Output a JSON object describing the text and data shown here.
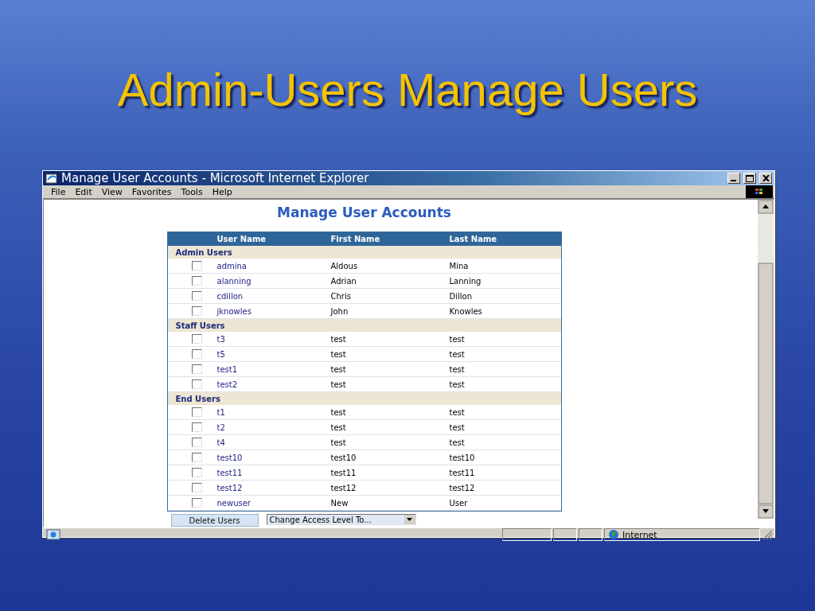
{
  "slide": {
    "title": "Admin-Users Manage Users"
  },
  "window": {
    "title": "Manage User Accounts - Microsoft Internet Explorer"
  },
  "menu": [
    "File",
    "Edit",
    "View",
    "Favorites",
    "Tools",
    "Help"
  ],
  "page": {
    "heading": "Manage User Accounts"
  },
  "table": {
    "columns": [
      "User Name",
      "First Name",
      "Last Name"
    ],
    "groups": [
      {
        "label": "Admin Users",
        "rows": [
          {
            "checked": false,
            "cells": [
              "admina",
              "Aldous",
              "Mina"
            ]
          },
          {
            "checked": false,
            "cells": [
              "alanning",
              "Adrian",
              "Lanning"
            ]
          },
          {
            "checked": false,
            "cells": [
              "cdillon",
              "Chris",
              "Dillon"
            ]
          },
          {
            "checked": false,
            "cells": [
              "jknowles",
              "John",
              "Knowles"
            ]
          }
        ]
      },
      {
        "label": "Staff Users",
        "rows": [
          {
            "checked": false,
            "cells": [
              "t3",
              "test",
              "test"
            ]
          },
          {
            "checked": false,
            "cells": [
              "t5",
              "test",
              "test"
            ]
          },
          {
            "checked": false,
            "cells": [
              "test1",
              "test",
              "test"
            ]
          },
          {
            "checked": false,
            "cells": [
              "test2",
              "test",
              "test"
            ]
          }
        ]
      },
      {
        "label": "End Users",
        "rows": [
          {
            "checked": false,
            "cells": [
              "t1",
              "test",
              "test"
            ]
          },
          {
            "checked": false,
            "cells": [
              "t2",
              "test",
              "test"
            ]
          },
          {
            "checked": false,
            "cells": [
              "t4",
              "test",
              "test"
            ]
          },
          {
            "checked": false,
            "cells": [
              "test10",
              "test10",
              "test10"
            ]
          },
          {
            "checked": false,
            "cells": [
              "test11",
              "test11",
              "test11"
            ]
          },
          {
            "checked": false,
            "cells": [
              "test12",
              "test12",
              "test12"
            ]
          },
          {
            "checked": false,
            "cells": [
              "newuser",
              "New",
              "User"
            ]
          }
        ]
      }
    ]
  },
  "actions": {
    "delete_button": "Delete Users",
    "access_dropdown": "Change Access Level To..."
  },
  "status_bar": {
    "zone": "Internet"
  }
}
